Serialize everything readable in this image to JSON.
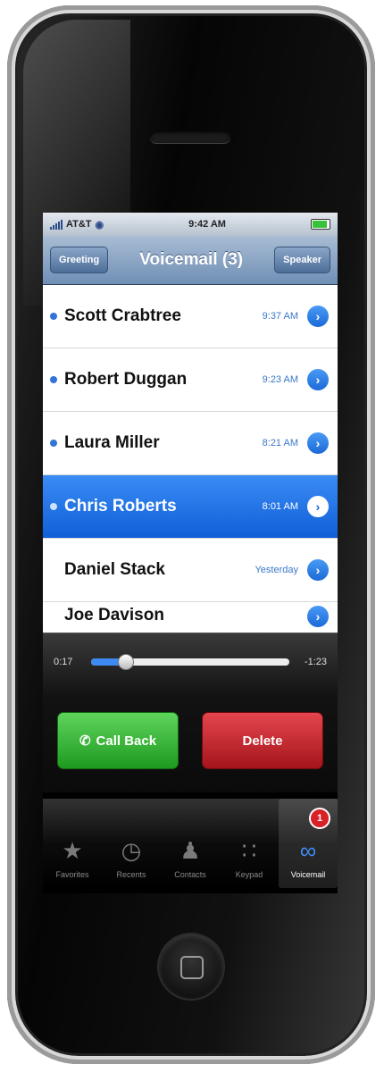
{
  "status": {
    "carrier": "AT&T",
    "time": "9:42 AM"
  },
  "nav": {
    "left_button": "Greeting",
    "title": "Voicemail (3)",
    "right_button": "Speaker"
  },
  "voicemails": [
    {
      "name": "Scott Crabtree",
      "time": "9:37 AM",
      "unread": true,
      "selected": false
    },
    {
      "name": "Robert Duggan",
      "time": "9:23 AM",
      "unread": true,
      "selected": false
    },
    {
      "name": "Laura Miller",
      "time": "8:21 AM",
      "unread": true,
      "selected": false
    },
    {
      "name": "Chris Roberts",
      "time": "8:01 AM",
      "unread": true,
      "selected": true
    },
    {
      "name": "Daniel Stack",
      "time": "Yesterday",
      "unread": false,
      "selected": false
    },
    {
      "name": "Joe Davison",
      "time": "",
      "unread": false,
      "selected": false
    }
  ],
  "player": {
    "elapsed": "0:17",
    "remaining": "-1:23",
    "progress": 0.17
  },
  "actions": {
    "call_back": "Call Back",
    "delete": "Delete"
  },
  "tabs": [
    {
      "label": "Favorites",
      "icon": "star-icon"
    },
    {
      "label": "Recents",
      "icon": "clock-icon"
    },
    {
      "label": "Contacts",
      "icon": "person-icon"
    },
    {
      "label": "Keypad",
      "icon": "keypad-icon"
    },
    {
      "label": "Voicemail",
      "icon": "voicemail-icon",
      "active": true,
      "badge": "1"
    }
  ],
  "colors": {
    "accent": "#3d8af2",
    "selected_row": "#1a6ae0",
    "call_green": "#2aa72a",
    "delete_red": "#c0202a"
  }
}
